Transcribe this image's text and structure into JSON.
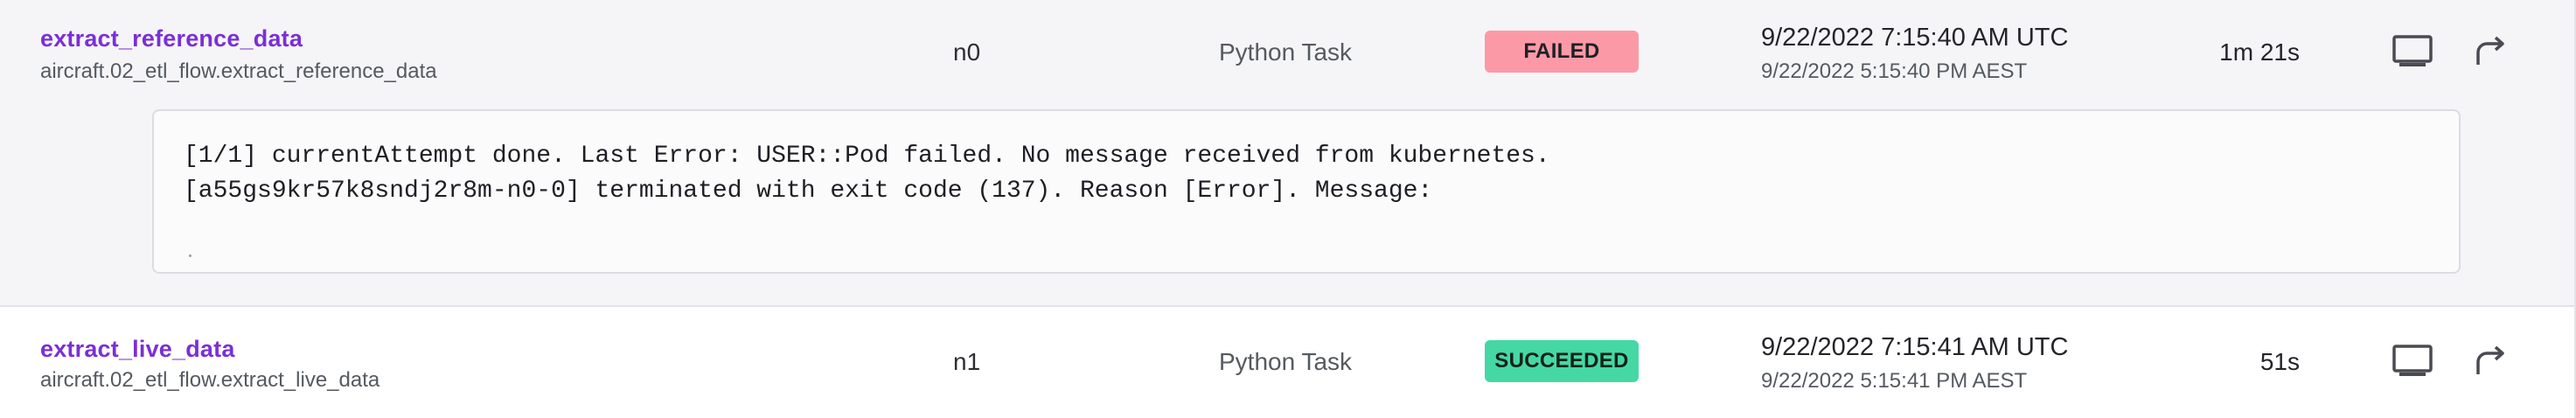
{
  "rows": [
    {
      "name": "extract_reference_data",
      "full_name": "aircraft.02_etl_flow.extract_reference_data",
      "node_id": "n0",
      "type": "Python Task",
      "status": "FAILED",
      "time_utc": "9/22/2022 7:15:40 AM UTC",
      "time_local": "9/22/2022 5:15:40 PM AEST",
      "duration": "1m 21s",
      "error_lines": [
        "[1/1] currentAttempt done. Last Error: USER::Pod failed. No message received from kubernetes.",
        "[a55gs9kr57k8sndj2r8m-n0-0] terminated with exit code (137). Reason [Error]. Message:"
      ]
    },
    {
      "name": "extract_live_data",
      "full_name": "aircraft.02_etl_flow.extract_live_data",
      "node_id": "n1",
      "type": "Python Task",
      "status": "SUCCEEDED",
      "time_utc": "9/22/2022 7:15:41 AM UTC",
      "time_local": "9/22/2022 5:15:41 PM AEST",
      "duration": "51s"
    }
  ],
  "icons": {
    "view_logs": "monitor-icon",
    "rerun": "rerun-arrow-icon"
  },
  "colors": {
    "link": "#7b2fd6",
    "failed_badge": "#fb9aa6",
    "succeeded_badge": "#45d8a5",
    "failed_row_bg": "#f5f5f8"
  }
}
